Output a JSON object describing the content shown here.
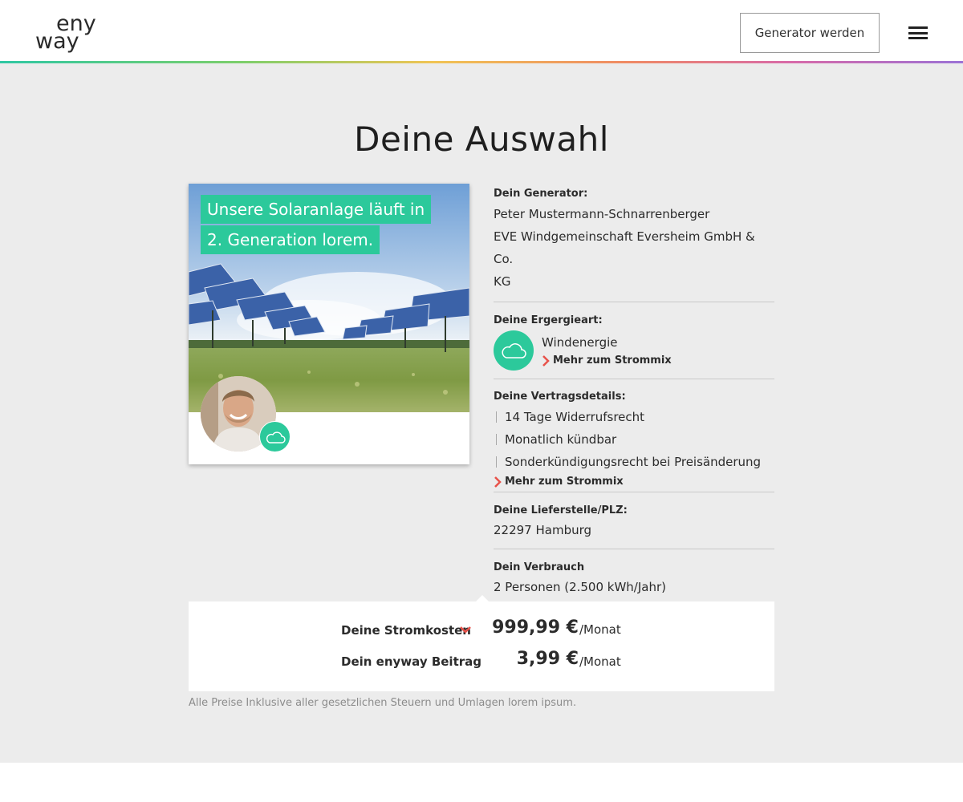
{
  "header": {
    "logo_top": "eny",
    "logo_bottom": "way",
    "cta_label": "Generator werden",
    "menu_icon": "hamburger-menu-icon"
  },
  "page": {
    "title": "Deine Auswahl"
  },
  "card": {
    "banner_line1": "Unsere Solaranlage läuft in",
    "banner_line2": "2. Generation lorem.",
    "badge_icon": "cloud-icon"
  },
  "details": {
    "generator": {
      "label": "Dein Generator:",
      "name": "Peter Mustermann-Schnarrenberger",
      "company_line1": "EVE Windgemeinschaft Eversheim GmbH & Co.",
      "company_line2": "KG"
    },
    "energy": {
      "label": "Deine Ergergieart:",
      "type": "Windenergie",
      "more": "Mehr zum Strommix",
      "icon": "cloud-icon"
    },
    "contract": {
      "label": "Deine Vertragsdetails:",
      "items": [
        "14 Tage Widerrufsrecht",
        "Monatlich kündbar",
        "Sonderkündigungsrecht bei Preisänderung"
      ],
      "more": "Mehr zum Strommix"
    },
    "delivery": {
      "label": "Deine Lieferstelle/PLZ:",
      "value": "22297 Hamburg"
    },
    "usage": {
      "label": "Dein Verbrauch",
      "value": "2 Personen (2.500 kWh/Jahr)"
    }
  },
  "prices": {
    "electricity_label": "Deine Stromkosten",
    "electricity_amount": "999,99 €",
    "electricity_unit": "/Monat",
    "contribution_label": "Dein enyway Beitrag",
    "contribution_amount": "3,99 €",
    "contribution_unit": "/Monat"
  },
  "footer_note": "Alle Preise Inklusive aller gesetzlichen Steuern und Umlagen lorem ipsum.",
  "colors": {
    "accent": "#2cc99b",
    "chevron": "#e8524a",
    "background": "#ececec"
  }
}
